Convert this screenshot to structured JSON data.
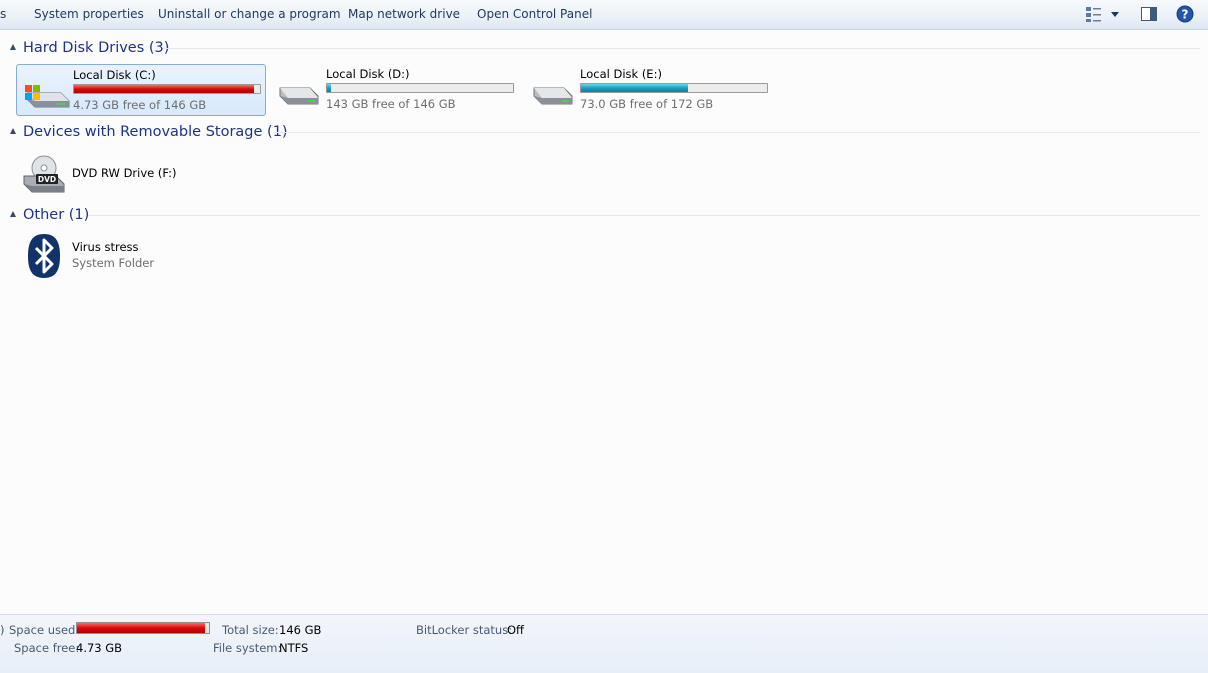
{
  "toolbar": {
    "cut_left": "s",
    "items": [
      "System properties",
      "Uninstall or change a program",
      "Map network drive",
      "Open Control Panel"
    ],
    "icons": [
      "change-view-icon",
      "chevron-down-icon",
      "preview-pane-icon",
      "help-icon"
    ]
  },
  "groups": {
    "hdd": {
      "title": "Hard Disk Drives (3)",
      "drives": [
        {
          "name": "Local Disk (C:)",
          "sub": "4.73 GB free of 146 GB",
          "used_fraction": 0.968,
          "bar_color": "#d60a0a",
          "selected": true,
          "icon": "windows-drive-icon"
        },
        {
          "name": "Local Disk (D:)",
          "sub": "143 GB free of 146 GB",
          "used_fraction": 0.02,
          "bar_color": "#1aa0c6",
          "selected": false,
          "icon": "hard-drive-icon"
        },
        {
          "name": "Local Disk (E:)",
          "sub": "73.0 GB free of 172 GB",
          "used_fraction": 0.576,
          "bar_color": "#1aa0c6",
          "selected": false,
          "icon": "hard-drive-icon"
        }
      ]
    },
    "removable": {
      "title": "Devices with Removable Storage (1)",
      "items": [
        {
          "name": "DVD RW Drive (F:)",
          "icon": "dvd-drive-icon",
          "icon_label": "DVD"
        }
      ]
    },
    "other": {
      "title": "Other (1)",
      "items": [
        {
          "name": "Virus stress",
          "sub": "System Folder",
          "icon": "bluetooth-icon"
        }
      ]
    }
  },
  "status": {
    "cut_left": ")",
    "space_used_label": "Space used:",
    "space_used_fraction": 0.968,
    "space_free_label": "Space free:",
    "space_free_value": "4.73 GB",
    "total_size_label": "Total size:",
    "total_size_value": "146 GB",
    "file_system_label": "File system:",
    "file_system_value": "NTFS",
    "bitlocker_label": "BitLocker status:",
    "bitlocker_value": "Off"
  }
}
